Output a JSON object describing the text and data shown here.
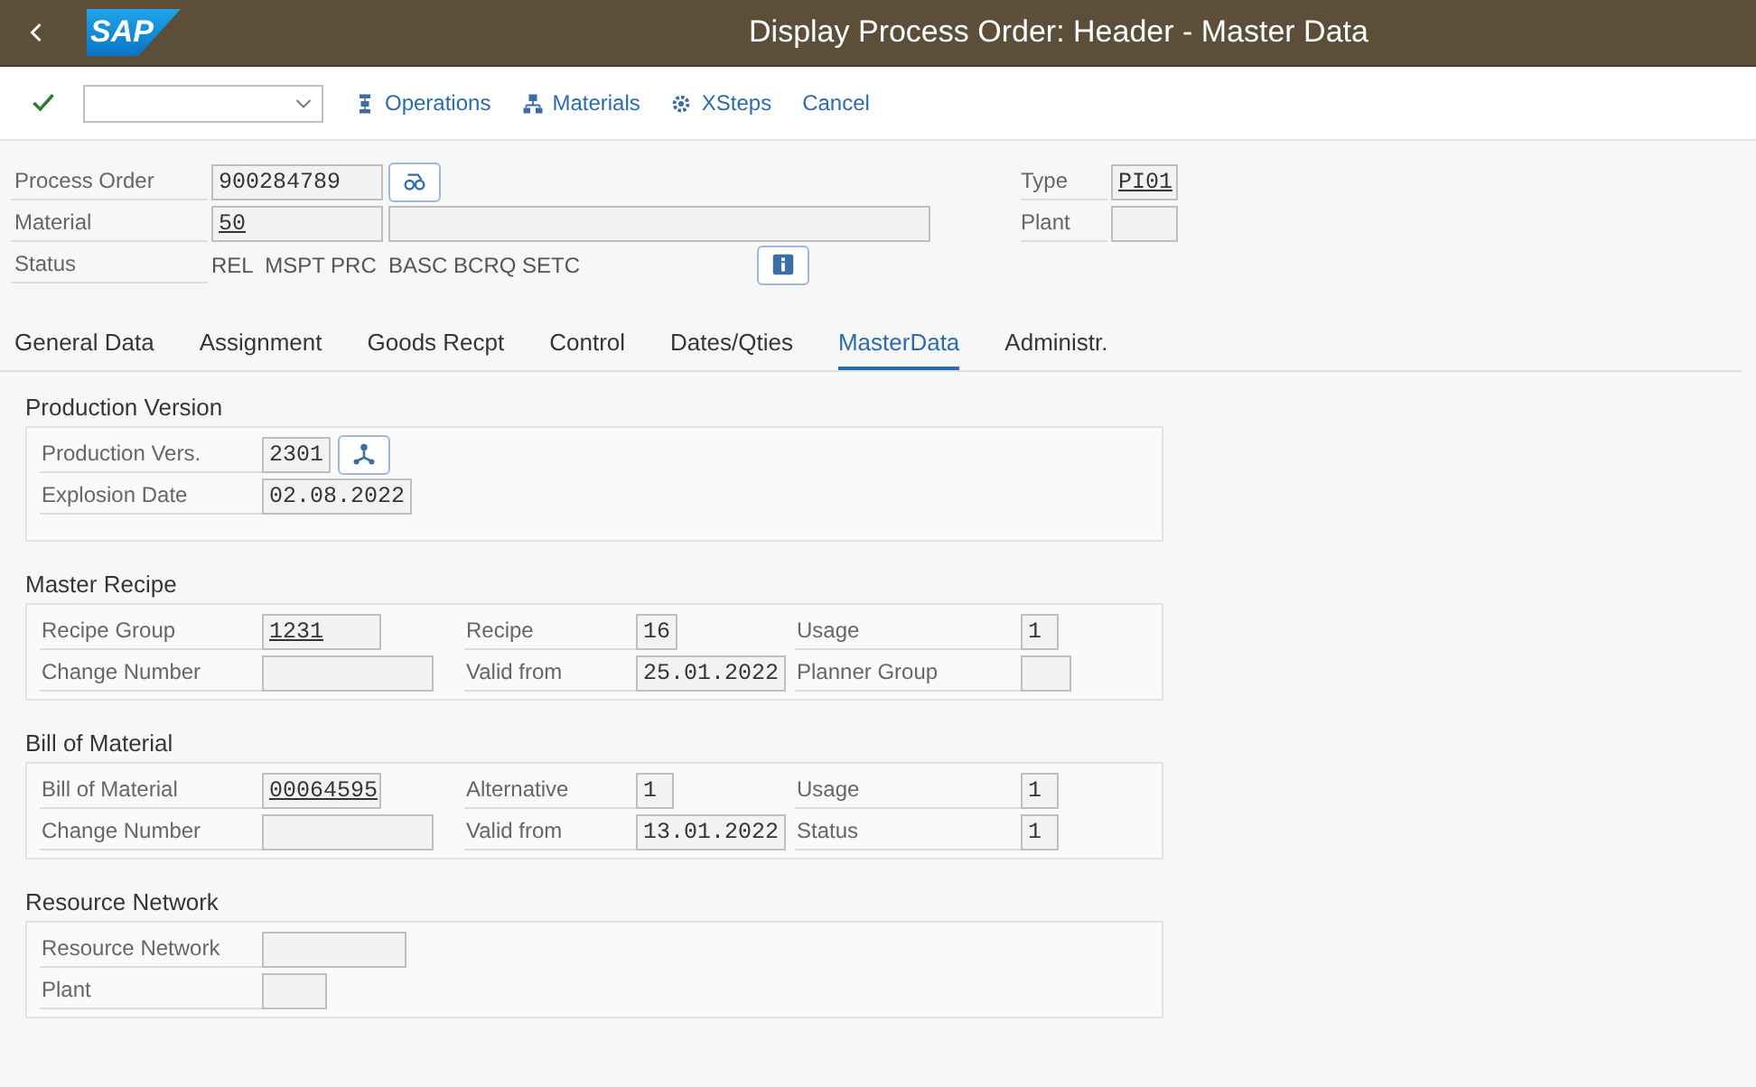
{
  "shell": {
    "logo": "SAP",
    "title": "Display Process Order: Header - Master Data"
  },
  "toolbar": {
    "items": [
      {
        "kind": "operations",
        "label": "Operations"
      },
      {
        "kind": "materials",
        "label": "Materials"
      },
      {
        "kind": "xsteps",
        "label": "XSteps"
      },
      {
        "kind": "plain",
        "label": "Cancel"
      }
    ]
  },
  "header": {
    "rows": [
      {
        "label": "Process Order",
        "fields": [
          {
            "kind": "key",
            "value": "900284789",
            "link": false
          }
        ],
        "right": {
          "label": "Type",
          "value": "PI01",
          "link": true
        }
      },
      {
        "label": "Material",
        "fields": [
          {
            "kind": "key",
            "value": "50",
            "link": true
          },
          {
            "kind": "description"
          }
        ],
        "right": {
          "label": "Plant"
        }
      },
      {
        "label": "Status",
        "text": "REL  MSPT PRC  BASC BCRQ SETC"
      }
    ]
  },
  "tabs": [
    {
      "label": "General Data",
      "selected": false
    },
    {
      "label": "Assignment",
      "selected": false
    },
    {
      "label": "Goods Recpt",
      "selected": false
    },
    {
      "label": "Control",
      "selected": false
    },
    {
      "label": "Dates/Qties",
      "selected": false
    },
    {
      "label": "MasterData",
      "selected": true
    },
    {
      "label": "Administr.",
      "selected": false
    }
  ],
  "sections": [
    {
      "title": "Production Version",
      "rows": [
        [
          {
            "label": "Production Vers.",
            "value": "2301",
            "link": false
          }
        ],
        [
          {
            "label": "Explosion Date",
            "value": "02.08.2022",
            "link": false
          }
        ]
      ]
    },
    {
      "title": "Master Recipe",
      "rows": [
        [
          {
            "label": "Recipe Group",
            "value": "1231",
            "link": true
          },
          {
            "label": "Recipe",
            "value": "16",
            "link": false
          },
          {
            "label": "Usage",
            "value": "1",
            "link": false
          }
        ],
        [
          {
            "label": "Change Number"
          },
          {
            "label": "Valid from",
            "value": "25.01.2022",
            "link": false
          },
          {
            "label": "Planner Group"
          }
        ]
      ]
    },
    {
      "title": "Bill of Material",
      "rows": [
        [
          {
            "label": "Bill of Material",
            "value": "00064595",
            "link": true
          },
          {
            "label": "Alternative",
            "value": "1",
            "link": false
          },
          {
            "label": "Usage",
            "value": "1",
            "link": false
          }
        ],
        [
          {
            "label": "Change Number"
          },
          {
            "label": "Valid from",
            "value": "13.01.2022",
            "link": false
          },
          {
            "label": "Status",
            "value": "1",
            "link": false
          }
        ]
      ]
    },
    {
      "title": "Resource Network",
      "rows": [
        [
          {
            "label": "Resource Network"
          }
        ],
        [
          {
            "label": "Plant"
          }
        ]
      ]
    }
  ]
}
